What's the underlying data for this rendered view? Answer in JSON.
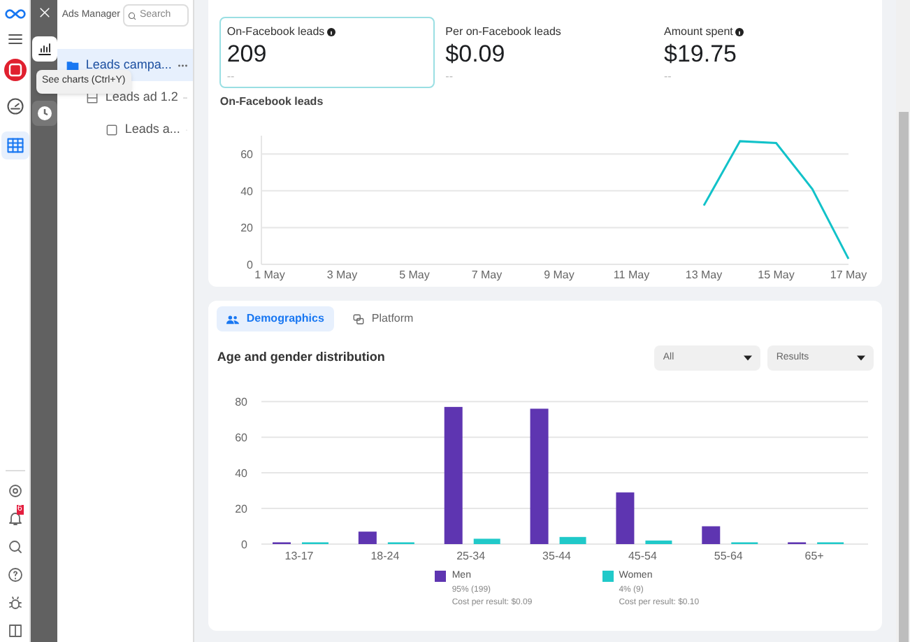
{
  "app": {
    "title": "Ads Manager",
    "tooltip": "See charts (Ctrl+Y)",
    "notification_badge": "6"
  },
  "rail_buttons": [
    {
      "kind": "chart",
      "selected": true
    },
    {
      "kind": "history",
      "selected": false
    }
  ],
  "nav_items": [
    {
      "kind": "gauge",
      "selected": false
    },
    {
      "kind": "table",
      "selected": true
    }
  ],
  "campaign_panel": {
    "search": {
      "placeholder": "Search"
    },
    "tree": [
      {
        "name": "Leads campa...",
        "kind": "campaign",
        "selected": true,
        "children": [
          {
            "name": "Leads ad 1.2",
            "kind": "adset",
            "selected": false,
            "children": [
              {
                "name": "Leads a...",
                "kind": "ad",
                "selected": false
              }
            ]
          }
        ]
      }
    ]
  },
  "metrics": [
    {
      "label": "On-Facebook leads",
      "value": "209",
      "delta": "--",
      "info": true,
      "selected": true
    },
    {
      "label": "Per on-Facebook leads",
      "value": "$0.09",
      "delta": "--",
      "info": false,
      "selected": false
    },
    {
      "label": "Amount spent",
      "value": "$19.75",
      "delta": "--",
      "info": true,
      "selected": false
    }
  ],
  "leads_chart": {
    "title": "On-Facebook leads",
    "chart_data": {
      "type": "line",
      "categories": [
        "1 May",
        null,
        "3 May",
        null,
        "5 May",
        null,
        "7 May",
        null,
        "9 May",
        null,
        "11 May",
        null,
        "13 May",
        null,
        "15 May",
        null,
        "17 May"
      ],
      "series": [
        {
          "color": "#12c2c9",
          "values": [
            null,
            null,
            null,
            null,
            null,
            null,
            null,
            null,
            null,
            null,
            null,
            null,
            32,
            67,
            66,
            41,
            3
          ]
        }
      ],
      "yticks": [
        0,
        20,
        40,
        60
      ],
      "ylim": [
        0,
        70
      ],
      "grid": true
    }
  },
  "breakdown_tabs": [
    {
      "label": "Demographics",
      "kind": "people",
      "selected": true
    },
    {
      "label": "Platform",
      "kind": "platform",
      "selected": false
    }
  ],
  "distribution": {
    "title": "Age and gender distribution",
    "filters": [
      {
        "value": "All"
      },
      {
        "value": "Results"
      }
    ],
    "chart_data": {
      "type": "bar",
      "categories": [
        "13-17",
        "18-24",
        "25-34",
        "35-44",
        "45-54",
        "55-64",
        "65+"
      ],
      "series": [
        {
          "name": "Men",
          "color": "#5e35b1",
          "values": [
            1,
            7,
            77,
            76,
            29,
            10,
            1
          ]
        },
        {
          "name": "Women",
          "color": "#20c9c9",
          "values": [
            1,
            1,
            3,
            4,
            2,
            1,
            1
          ]
        }
      ],
      "yticks": [
        0,
        20,
        40,
        60,
        80
      ],
      "ylim": [
        0,
        80
      ],
      "grid": true
    },
    "legend": [
      {
        "share": "95% (199)",
        "cost": "Cost per result: $0.09"
      },
      {
        "share": "4% (9)",
        "cost": "Cost per result: $0.10"
      }
    ]
  }
}
